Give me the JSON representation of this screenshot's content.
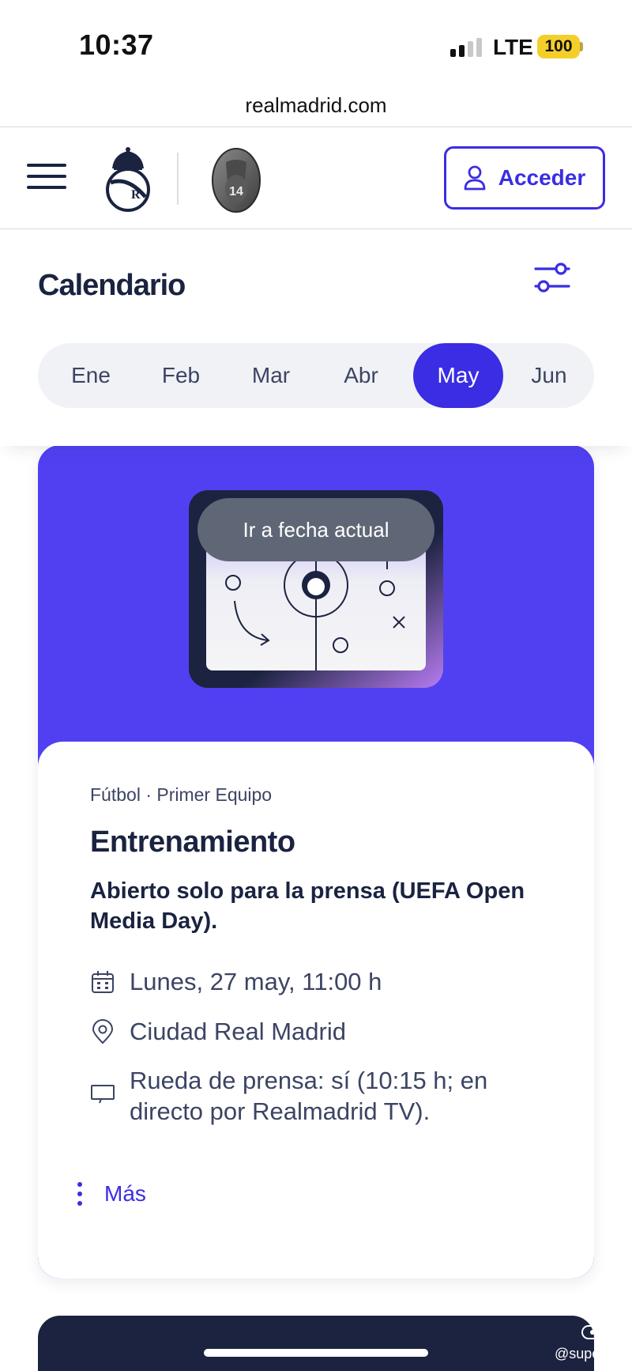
{
  "status_bar": {
    "time": "10:37",
    "network": "LTE",
    "battery": "100"
  },
  "browser": {
    "url": "realmadrid.com"
  },
  "header": {
    "login_label": "Acceder",
    "badge_number": "14"
  },
  "calendar": {
    "title": "Calendario",
    "months": [
      {
        "label": "Ene",
        "active": false
      },
      {
        "label": "Feb",
        "active": false
      },
      {
        "label": "Mar",
        "active": false
      },
      {
        "label": "Abr",
        "active": false
      },
      {
        "label": "May",
        "active": true
      },
      {
        "label": "Jun",
        "active": false
      }
    ]
  },
  "toast": {
    "label": "Ir a fecha actual"
  },
  "event": {
    "category": "Fútbol · Primer Equipo",
    "title": "Entrenamiento",
    "subtitle": "Abierto solo para la prensa (UEFA Open Media Day).",
    "date": "Lunes, 27 may, 11:00 h",
    "location": "Ciudad Real Madrid",
    "press": "Rueda de prensa: sí (10:15 h; en directo por Realmadrid TV).",
    "more_label": "Más"
  },
  "watermark": "@superdev",
  "colors": {
    "accent": "#3a2de3",
    "card_header": "#5140f2",
    "text_dark": "#1a2340",
    "text_muted": "#3c4463",
    "toast_bg": "#5f6776",
    "battery": "#f4cf2a"
  }
}
